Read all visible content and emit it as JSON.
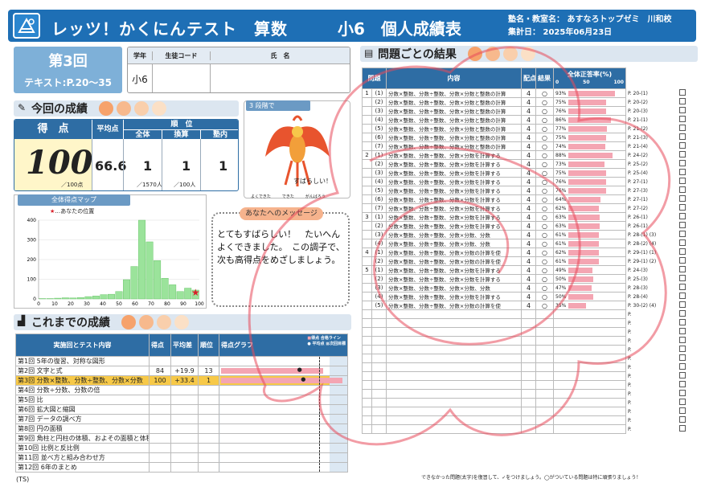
{
  "header": {
    "title": "レッツ！かくにんテスト　算数",
    "grade_title": "小6　個人成績表",
    "school_label": "塾名・教室名：",
    "school_name": "あすなろトップゼミ　川和校",
    "date_label": "集計日：",
    "date": "2025年06月23日"
  },
  "round": {
    "name": "第3回",
    "text": "テキスト:P.20〜35"
  },
  "student": {
    "grade_label": "学年",
    "code_label": "生徒コード",
    "name_label": "氏　名",
    "grade": "小6",
    "code": "",
    "name": ""
  },
  "current": {
    "section": "今回の成績",
    "score_label": "得　点",
    "avg_label": "平均点",
    "rank_label": "順　位",
    "rank_all": "全体",
    "rank_conv": "換算",
    "rank_school": "塾内",
    "score": "100",
    "score_max": "／100点",
    "avg": "66.6",
    "rank_all_v": "1",
    "rank_conv_v": "1",
    "rank_school_v": "1",
    "rank_all_total": "／1570人",
    "rank_conv_total": "／100人"
  },
  "character": {
    "label": "3 段階で",
    "speech": "すばらしい！",
    "legend": [
      "よくできた",
      "できた",
      "がんばろう"
    ]
  },
  "message": {
    "label": "あなたへのメッセージ",
    "text": "とてもすばらしい！　たいへんよくできました。　この調子で、次も高得点をめざしましょう。"
  },
  "distribution": {
    "title": "全体得点マップ",
    "legend": "…あなたの位置",
    "colors": {
      "bar": "#9be39b",
      "mark": "#d9202a"
    }
  },
  "chart_data": {
    "type": "bar",
    "title": "全体得点マップ",
    "categories": [
      "0",
      "5",
      "10",
      "15",
      "20",
      "25",
      "30",
      "35",
      "40",
      "45",
      "50",
      "55",
      "60",
      "65",
      "70",
      "75",
      "80",
      "85",
      "90",
      "95",
      "100"
    ],
    "values": [
      2,
      2,
      4,
      6,
      5,
      7,
      12,
      15,
      22,
      24,
      38,
      98,
      165,
      420,
      290,
      195,
      105,
      72,
      38,
      55,
      45
    ],
    "ylim": [
      0,
      400
    ],
    "yticks": [
      "0",
      "100",
      "200",
      "300",
      "400"
    ],
    "xticks": [
      "0",
      "10",
      "20",
      "30",
      "40",
      "50",
      "60",
      "70",
      "80",
      "90",
      "100"
    ],
    "marker_score": 100
  },
  "history": {
    "section": "これまでの成績",
    "col_content": "実施回とテスト内容",
    "col_score": "得点",
    "col_diff": "平均差",
    "col_rank": "順位",
    "col_graph": "得点グラフ",
    "legend": [
      "得点",
      "合格ライン",
      "平均点",
      "次回目標"
    ],
    "axis": [
      "0",
      "10",
      "20",
      "30",
      "40",
      "50",
      "60",
      "70",
      "80",
      "90",
      "100"
    ],
    "rows": [
      {
        "round": "第1回",
        "content": "5年の復習、対称な図形",
        "score": "",
        "diff": "",
        "rank": ""
      },
      {
        "round": "第2回",
        "content": "文字と式",
        "score": "84",
        "diff": "+19.9",
        "rank": "13",
        "bar": 84,
        "avg": 64
      },
      {
        "round": "第3回",
        "content": "分数×整数、分数÷整数、分数×分数",
        "score": "100",
        "diff": "+33.4",
        "rank": "1",
        "bar": 100,
        "avg": 67
      },
      {
        "round": "第4回",
        "content": "分数÷分数、分数の倍",
        "score": "",
        "diff": "",
        "rank": ""
      },
      {
        "round": "第5回",
        "content": "比",
        "score": "",
        "diff": "",
        "rank": ""
      },
      {
        "round": "第6回",
        "content": "拡大図と縮図",
        "score": "",
        "diff": "",
        "rank": ""
      },
      {
        "round": "第7回",
        "content": "データの調べ方",
        "score": "",
        "diff": "",
        "rank": ""
      },
      {
        "round": "第8回",
        "content": "円の面積",
        "score": "",
        "diff": "",
        "rank": ""
      },
      {
        "round": "第9回",
        "content": "角柱と円柱の体積、およその面積と体積",
        "score": "",
        "diff": "",
        "rank": ""
      },
      {
        "round": "第10回",
        "content": "比例と反比例",
        "score": "",
        "diff": "",
        "rank": ""
      },
      {
        "round": "第11回",
        "content": "並べ方と組み合わせ方",
        "score": "",
        "diff": "",
        "rank": ""
      },
      {
        "round": "第12回",
        "content": "6年のまとめ",
        "score": "",
        "diff": "",
        "rank": ""
      }
    ]
  },
  "problems": {
    "section": "問題ごとの結果",
    "col_no": "問題",
    "col_content": "内容",
    "col_pts": "配点",
    "col_result": "結果",
    "col_rate": "全体正答率(%)",
    "rate_ticks": [
      "0",
      "50",
      "100"
    ],
    "rows": [
      {
        "big": "1",
        "small": "(1)",
        "content": "分数×整数、分数÷整数、分数×分数と整数の計算",
        "pts": "4",
        "res": "○",
        "rate": "93%",
        "r": 93,
        "page": "P. 20-(1)"
      },
      {
        "big": "",
        "small": "(2)",
        "content": "分数×整数、分数÷整数、分数×分数と整数の計算",
        "pts": "4",
        "res": "○",
        "rate": "75%",
        "r": 75,
        "page": "P. 20-(2)"
      },
      {
        "big": "",
        "small": "(3)",
        "content": "分数×整数、分数÷整数、分数×分数と整数の計算",
        "pts": "4",
        "res": "○",
        "rate": "76%",
        "r": 76,
        "page": "P. 20-(3)"
      },
      {
        "big": "",
        "small": "(4)",
        "content": "分数×整数、分数÷整数、分数×分数と整数の計算",
        "pts": "4",
        "res": "○",
        "rate": "86%",
        "r": 86,
        "page": "P. 21-(1)"
      },
      {
        "big": "",
        "small": "(5)",
        "content": "分数×整数、分数÷整数、分数×分数と整数の計算",
        "pts": "4",
        "res": "○",
        "rate": "77%",
        "r": 77,
        "page": "P. 21-(2)"
      },
      {
        "big": "",
        "small": "(6)",
        "content": "分数×整数、分数÷整数、分数×分数と整数の計算",
        "pts": "4",
        "res": "○",
        "rate": "75%",
        "r": 75,
        "page": "P. 21-(3)"
      },
      {
        "big": "",
        "small": "(7)",
        "content": "分数×整数、分数÷整数、分数×分数と整数の計算",
        "pts": "4",
        "res": "○",
        "rate": "74%",
        "r": 74,
        "page": "P. 21-(4)"
      },
      {
        "big": "2",
        "small": "(1)",
        "content": "分数×整数、分数÷整数、分数×分数を計算する",
        "pts": "4",
        "res": "○",
        "rate": "88%",
        "r": 88,
        "page": "P. 24-(2)"
      },
      {
        "big": "",
        "small": "(2)",
        "content": "分数×整数、分数÷整数、分数×分数を計算する",
        "pts": "4",
        "res": "○",
        "rate": "73%",
        "r": 73,
        "page": "P. 25-(2)"
      },
      {
        "big": "",
        "small": "(3)",
        "content": "分数×整数、分数÷整数、分数×分数を計算する",
        "pts": "4",
        "res": "○",
        "rate": "75%",
        "r": 75,
        "page": "P. 25-(4)"
      },
      {
        "big": "",
        "small": "(4)",
        "content": "分数×整数、分数÷整数、分数×分数を計算する",
        "pts": "4",
        "res": "○",
        "rate": "76%",
        "r": 76,
        "page": "P. 27-(1)"
      },
      {
        "big": "",
        "small": "(5)",
        "content": "分数×整数、分数÷整数、分数×分数を計算する",
        "pts": "4",
        "res": "○",
        "rate": "76%",
        "r": 76,
        "page": "P. 27-(3)"
      },
      {
        "big": "",
        "small": "(6)",
        "content": "分数×整数、分数÷整数、分数×分数を計算する",
        "pts": "4",
        "res": "○",
        "rate": "64%",
        "r": 64,
        "page": "P. 27-(1)"
      },
      {
        "big": "",
        "small": "(7)",
        "content": "分数×整数、分数÷整数、分数×分数を計算する",
        "pts": "4",
        "res": "○",
        "rate": "62%",
        "r": 62,
        "page": "P. 27-(2)"
      },
      {
        "big": "3",
        "small": "(1)",
        "content": "分数×整数、分数÷整数、分数×分数を計算する",
        "pts": "4",
        "res": "○",
        "rate": "63%",
        "r": 63,
        "page": "P. 26-(1)"
      },
      {
        "big": "",
        "small": "(2)",
        "content": "分数×整数、分数÷整数、分数×分数を計算する",
        "pts": "4",
        "res": "○",
        "rate": "63%",
        "r": 63,
        "page": "P. 26-(1)"
      },
      {
        "big": "",
        "small": "(3)",
        "content": "分数×整数、分数÷整数、分数×分数、分数",
        "pts": "4",
        "res": "○",
        "rate": "61%",
        "r": 61,
        "page": "P. 28-(1) (3)"
      },
      {
        "big": "",
        "small": "(4)",
        "content": "分数×整数、分数÷整数、分数×分数、分数",
        "pts": "4",
        "res": "○",
        "rate": "61%",
        "r": 61,
        "page": "P. 28-(2) (4)"
      },
      {
        "big": "4",
        "small": "(1)",
        "content": "分数×整数、分数÷整数、分数×分数の計算を使",
        "pts": "4",
        "res": "○",
        "rate": "62%",
        "r": 62,
        "page": "P. 29-(1) (1)"
      },
      {
        "big": "",
        "small": "(2)",
        "content": "分数×整数、分数÷整数、分数×分数の計算を使",
        "pts": "4",
        "res": "○",
        "rate": "61%",
        "r": 61,
        "page": "P. 29-(1) (2)"
      },
      {
        "big": "5",
        "small": "(1)",
        "content": "分数×整数、分数÷整数、分数×分数を計算する",
        "pts": "4",
        "res": "○",
        "rate": "49%",
        "r": 49,
        "page": "P. 24-(3)"
      },
      {
        "big": "",
        "small": "(2)",
        "content": "分数×整数、分数÷整数、分数×分数を計算する",
        "pts": "4",
        "res": "○",
        "rate": "50%",
        "r": 50,
        "page": "P. 25-(3)"
      },
      {
        "big": "",
        "small": "(3)",
        "content": "分数×整数、分数÷整数、分数×分数、分数",
        "pts": "4",
        "res": "○",
        "rate": "47%",
        "r": 47,
        "page": "P. 28-(3)"
      },
      {
        "big": "",
        "small": "(4)",
        "content": "分数×整数、分数÷整数、分数×分数を計算する",
        "pts": "4",
        "res": "○",
        "rate": "50%",
        "r": 50,
        "page": "P. 28-(4)"
      },
      {
        "big": "",
        "small": "(5)",
        "content": "分数×整数、分数÷整数、分数×分数の計算を使",
        "pts": "4",
        "res": "○",
        "rate": "35%",
        "r": 35,
        "page": "P. 30-(2) (4)"
      }
    ],
    "empty_rows": 14,
    "footer": "できなかった問題(太字)を復習して、✓をつけましょう。◯がついている問題は特に頑張りましょう！"
  },
  "footer_left": "(TS)"
}
